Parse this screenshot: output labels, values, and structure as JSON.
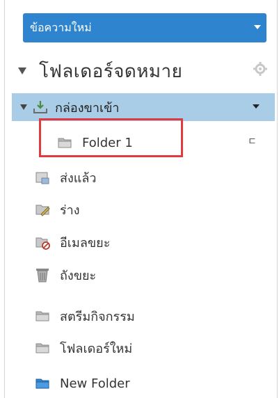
{
  "compose": {
    "label": "ข้อความใหม่"
  },
  "mailbox": {
    "title": "โฟลเดอร์จดหมาย"
  },
  "folders": {
    "inbox": "กล่องขาเข้า",
    "folder1": "Folder 1",
    "sent": "ส่งแล้ว",
    "drafts": "ร่าง",
    "junk": "อีเมลขยะ",
    "trash": "ถังขยะ",
    "activity": "สตรีมกิจกรรม",
    "new_folder_th": "โฟลเดอร์ใหม่",
    "new_folder_en": "New Folder"
  },
  "misc": {
    "corner_mark": "ㄷ"
  },
  "colors": {
    "accent": "#2f84cf",
    "selected_row": "#a9cde7",
    "highlight_box": "#e0393e"
  },
  "icons": [
    "chevron-down-icon",
    "gear-icon",
    "inbox-download-icon",
    "folder-icon",
    "sent-icon",
    "drafts-pencil-icon",
    "junk-icon",
    "trash-icon",
    "folder-blue-icon"
  ]
}
